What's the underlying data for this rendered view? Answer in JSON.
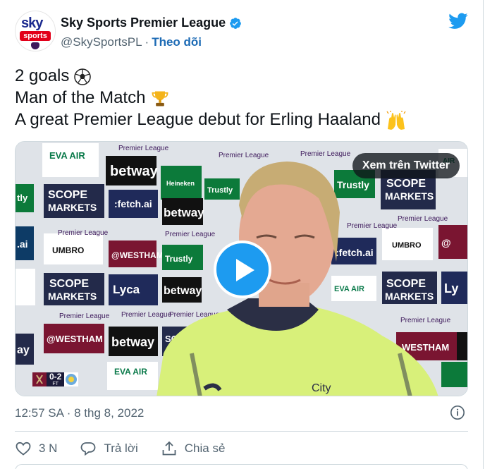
{
  "author": {
    "display_name": "Sky Sports Premier League",
    "handle": "@SkySportsPL",
    "separator": "·",
    "follow_label": "Theo dõi",
    "avatar_text_top": "sky",
    "avatar_text_bottom": "sports",
    "verified_icon": "verified-badge-icon"
  },
  "tweet": {
    "lines": [
      {
        "text": "2 goals",
        "emoji": "soccer-ball"
      },
      {
        "text": "Man of the Match",
        "emoji": "trophy"
      },
      {
        "text": "A great Premier League debut for Erling Haaland",
        "emoji": "raised-hands"
      }
    ]
  },
  "media": {
    "watch_label": "Xem trên Twitter",
    "score": "0-2",
    "score_status": "FT",
    "sponsor_boards": [
      "EVA AIR",
      "betway",
      "SCOPE MARKETS",
      "fetch.ai",
      "Premier League",
      "Trustly",
      "@WESTHAM",
      "Lyca Mobile",
      "Heineken 0.0",
      "UMBRO"
    ]
  },
  "meta": {
    "timestamp": "12:57 SA · 8 thg 8, 2022"
  },
  "actions": {
    "like_count": "3 N",
    "reply_label": "Trả lời",
    "share_label": "Chia sẻ"
  },
  "colors": {
    "twitter_blue": "#1d9bf0",
    "link_blue": "#1d6bb5",
    "secondary_text": "#536471",
    "shirt": "#d8f07a"
  }
}
